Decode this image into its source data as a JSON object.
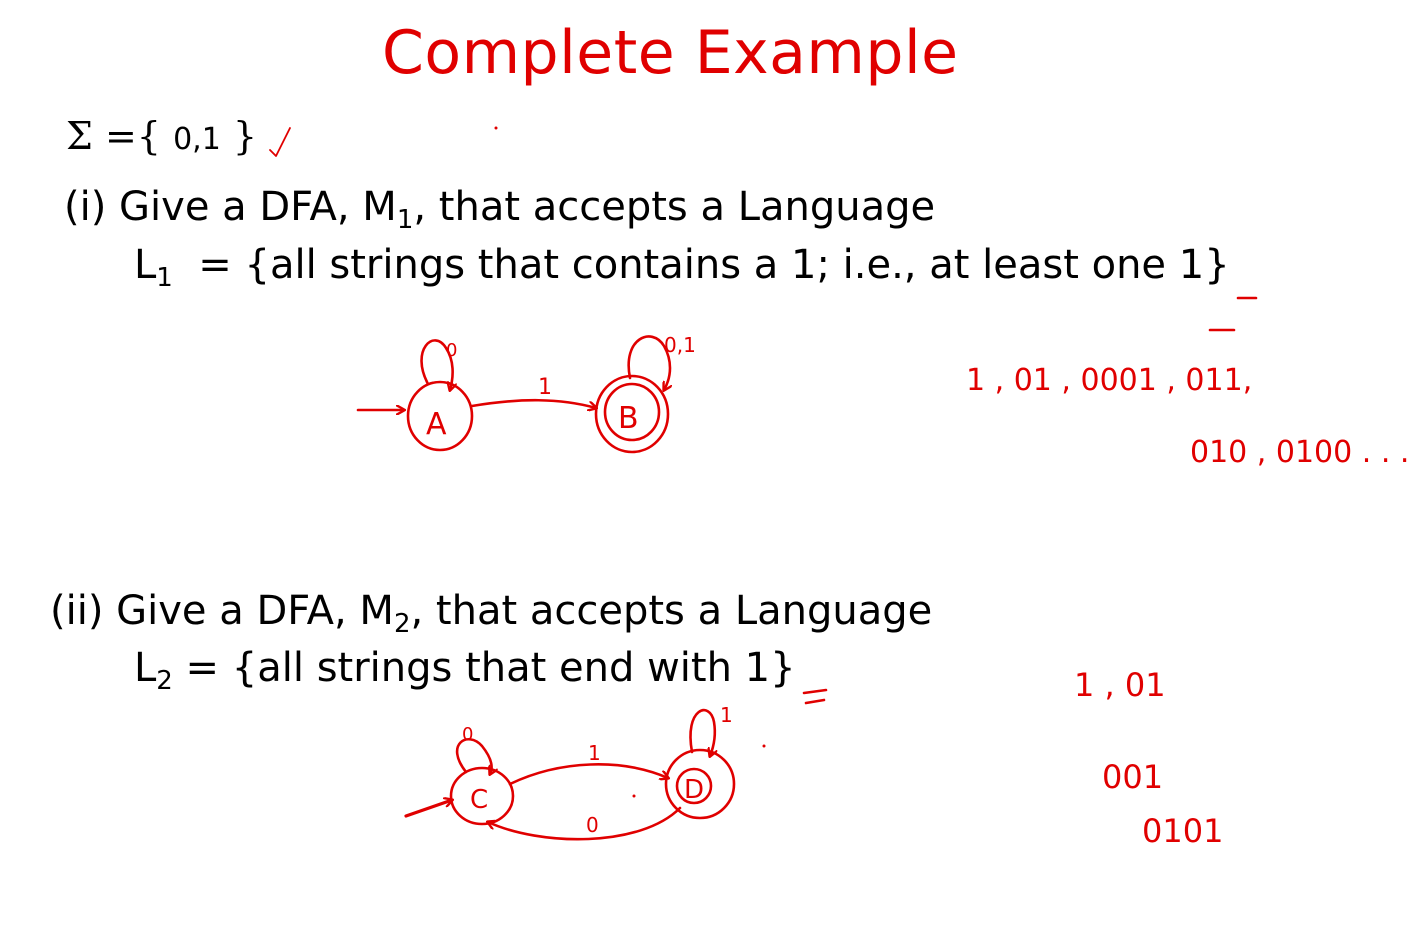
{
  "title": "Complete Example",
  "alphabet": {
    "symbol": "Σ =",
    "open": "{",
    "values": "0,1",
    "close": "}"
  },
  "part1": {
    "label": "(i) Give a DFA, M",
    "machine_sub": "1",
    "tail": ", that accepts a Language",
    "lang_name": "L",
    "lang_sub": "1",
    "lang_def": "  = {all strings that contains a 1; i.e., at least one 1}"
  },
  "part2": {
    "label": "(ii) Give a DFA, M",
    "machine_sub": "2",
    "tail": ", that accepts a Language",
    "lang_name": "L",
    "lang_sub": "2",
    "lang_def": " = {all strings that end with 1}"
  },
  "dfa1": {
    "states": [
      "A",
      "B"
    ],
    "loop_A": "0",
    "edge_AB": "1",
    "loop_B": "0,1"
  },
  "dfa2": {
    "states": [
      "C",
      "D"
    ],
    "loop_C": "0",
    "edge_CD": "1",
    "edge_DC": "0",
    "loop_D": "1"
  },
  "examples1": {
    "row1": "1 , 01 , 0001 , 011,",
    "row2": "010 , 0100 . . ."
  },
  "examples2": {
    "row1": "1 ,  01",
    "row2": "001",
    "row3": "0101"
  },
  "ink_color": "#e00000"
}
